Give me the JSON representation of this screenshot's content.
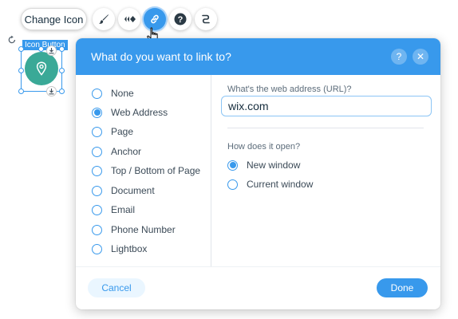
{
  "toolbar": {
    "change_icon_label": "Change Icon",
    "buttons": [
      {
        "icon": "paintbrush-icon"
      },
      {
        "icon": "animation-icon"
      },
      {
        "icon": "link-icon",
        "active": true
      },
      {
        "icon": "help-icon"
      },
      {
        "icon": "connect-icon"
      }
    ]
  },
  "element": {
    "label": "Icon Button",
    "icon": "location-pin-icon",
    "color": "#3aa997"
  },
  "dialog": {
    "title": "What do you want to link to?",
    "help_symbol": "?",
    "close_symbol": "✕",
    "link_types": [
      {
        "label": "None",
        "selected": false
      },
      {
        "label": "Web Address",
        "selected": true
      },
      {
        "label": "Page",
        "selected": false
      },
      {
        "label": "Anchor",
        "selected": false
      },
      {
        "label": "Top / Bottom of Page",
        "selected": false
      },
      {
        "label": "Document",
        "selected": false
      },
      {
        "label": "Email",
        "selected": false
      },
      {
        "label": "Phone Number",
        "selected": false
      },
      {
        "label": "Lightbox",
        "selected": false
      }
    ],
    "url_label": "What's the web address (URL)?",
    "url_value": "wix.com",
    "open_label": "How does it open?",
    "open_options": [
      {
        "label": "New window",
        "selected": true
      },
      {
        "label": "Current window",
        "selected": false
      }
    ],
    "cancel_label": "Cancel",
    "done_label": "Done"
  },
  "colors": {
    "accent": "#3899ec",
    "accent_light": "#eaf6ff",
    "text_dark": "#162d3d"
  }
}
